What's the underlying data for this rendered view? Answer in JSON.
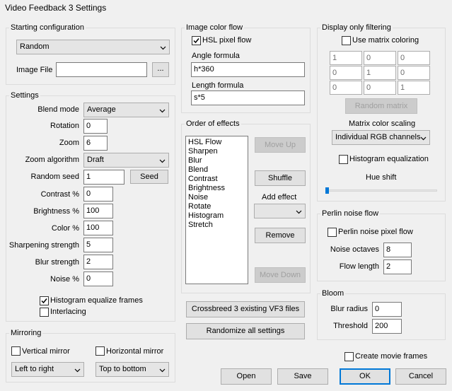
{
  "window": {
    "title": "Video Feedback 3 Settings"
  },
  "starting": {
    "legend": "Starting configuration",
    "preset": "Random",
    "image_file_label": "Image File",
    "image_file_value": "",
    "browse_label": "..."
  },
  "settings": {
    "legend": "Settings",
    "blend_mode_label": "Blend mode",
    "blend_mode_value": "Average",
    "rotation_label": "Rotation",
    "rotation_value": "0",
    "zoom_label": "Zoom",
    "zoom_value": "6",
    "zoom_algorithm_label": "Zoom algorithm",
    "zoom_algorithm_value": "Draft",
    "random_seed_label": "Random seed",
    "random_seed_value": "1",
    "seed_button": "Seed",
    "contrast_label": "Contrast %",
    "contrast_value": "0",
    "brightness_label": "Brightness %",
    "brightness_value": "100",
    "color_label": "Color %",
    "color_value": "100",
    "sharpening_label": "Sharpening strength",
    "sharpening_value": "5",
    "blur_label": "Blur strength",
    "blur_value": "2",
    "noise_label": "Noise %",
    "noise_value": "0",
    "histogram_eq_label": "Histogram equalize frames",
    "histogram_eq_checked": true,
    "interlacing_label": "Interlacing",
    "interlacing_checked": false
  },
  "mirroring": {
    "legend": "Mirroring",
    "vertical_label": "Vertical mirror",
    "horizontal_label": "Horizontal mirror",
    "vertical_mode": "Left to right",
    "horizontal_mode": "Top to bottom"
  },
  "image_color_flow": {
    "legend": "Image color flow",
    "hsl_label": "HSL pixel flow",
    "hsl_checked": true,
    "angle_label": "Angle formula",
    "angle_value": "h*360",
    "length_label": "Length formula",
    "length_value": "s*5"
  },
  "order_of_effects": {
    "legend": "Order of effects",
    "items": [
      "HSL Flow",
      "Sharpen",
      "Blur",
      "Blend",
      "Contrast",
      "Brightness",
      "Noise",
      "Rotate",
      "Histogram",
      "Stretch"
    ],
    "move_up": "Move Up",
    "shuffle": "Shuffle",
    "add_effect_label": "Add effect",
    "add_effect_value": "",
    "remove": "Remove",
    "move_down": "Move Down"
  },
  "actions": {
    "crossbreed": "Crossbreed 3 existing VF3 files",
    "randomize": "Randomize all settings",
    "open": "Open",
    "save": "Save",
    "ok": "OK",
    "cancel": "Cancel"
  },
  "display_filtering": {
    "legend": "Display only filtering",
    "use_matrix_label": "Use matrix coloring",
    "use_matrix_checked": false,
    "matrix": [
      [
        "1",
        "0",
        "0"
      ],
      [
        "0",
        "1",
        "0"
      ],
      [
        "0",
        "0",
        "1"
      ]
    ],
    "random_matrix": "Random matrix",
    "color_scaling_label": "Matrix color scaling",
    "color_scaling_value": "Individual RGB channels",
    "histogram_label": "Histogram equalization",
    "histogram_checked": false,
    "hue_shift_label": "Hue shift",
    "hue_shift_level": 0
  },
  "perlin": {
    "legend": "Perlin noise flow",
    "pixel_flow_label": "Perlin noise pixel flow",
    "pixel_flow_checked": false,
    "octaves_label": "Noise octaves",
    "octaves_value": "8",
    "flow_length_label": "Flow length",
    "flow_length_value": "2"
  },
  "bloom": {
    "legend": "Bloom",
    "blur_radius_label": "Blur radius",
    "blur_radius_value": "0",
    "threshold_label": "Threshold",
    "threshold_value": "200"
  },
  "movie": {
    "create_label": "Create movie frames",
    "create_checked": false
  }
}
